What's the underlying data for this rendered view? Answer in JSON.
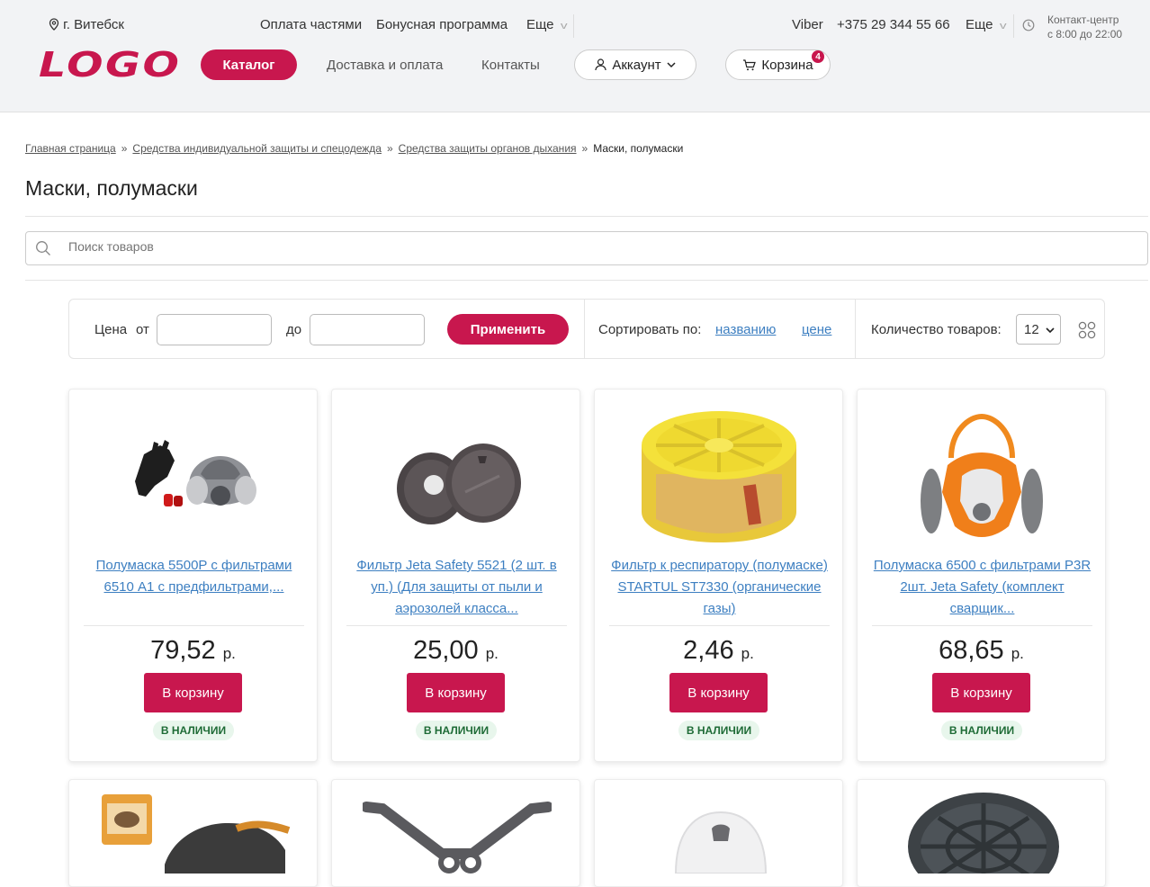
{
  "topbar": {
    "city": "г. Витебск",
    "links": [
      "Оплата частями",
      "Бонусная программа",
      "Еще"
    ],
    "viber": "Viber",
    "phone": "+375 29 344 55 66",
    "more": "Еще",
    "contact_line1": "Контакт-центр",
    "contact_line2": "с 8:00 до 22:00"
  },
  "header": {
    "logo": "LOGO",
    "catalog": "Каталог",
    "nav": [
      "Доставка и оплата",
      "Контакты"
    ],
    "account": "Аккаунт",
    "cart": "Корзина",
    "cart_count": "4"
  },
  "breadcrumbs": [
    "Главная страница",
    "Средства индивидуальной защиты и спецодежда",
    "Средства защиты органов дыхания",
    "Маски, полумаски"
  ],
  "page_title": "Маски, полумаски",
  "search": {
    "placeholder": "Поиск товаров"
  },
  "filters": {
    "price_label": "Цена",
    "from": "от",
    "to": "до",
    "apply": "Применить",
    "sort_label": "Сортировать по:",
    "sort_name": "названию",
    "sort_price": "цене",
    "count_label": "Количество товаров:",
    "count_value": "12"
  },
  "products": [
    {
      "title": "Полумаска 5500P с фильтрами 6510 A1 с предфильтрами,...",
      "price": "79,52",
      "currency": "р.",
      "buy": "В корзину",
      "stock": "В НАЛИЧИИ"
    },
    {
      "title": "Фильтр Jeta Safety 5521 (2 шт. в уп.) (Для защиты от пыли и аэрозолей класса...",
      "price": "25,00",
      "currency": "р.",
      "buy": "В корзину",
      "stock": "В НАЛИЧИИ"
    },
    {
      "title": "Фильтр к респиратору (полумаске) STARTUL ST7330 (органические газы)",
      "price": "2,46",
      "currency": "р.",
      "buy": "В корзину",
      "stock": "В НАЛИЧИИ"
    },
    {
      "title": "Полумаска 6500 с фильтрами P3R 2шт. Jeta Safety (комплект сварщик...",
      "price": "68,65",
      "currency": "р.",
      "buy": "В корзину",
      "stock": "В НАЛИЧИИ"
    }
  ],
  "colors": {
    "accent": "#c8174e",
    "link": "#3d7fc1",
    "stock_bg": "#e8f6ec",
    "stock_text": "#1e6b36"
  }
}
